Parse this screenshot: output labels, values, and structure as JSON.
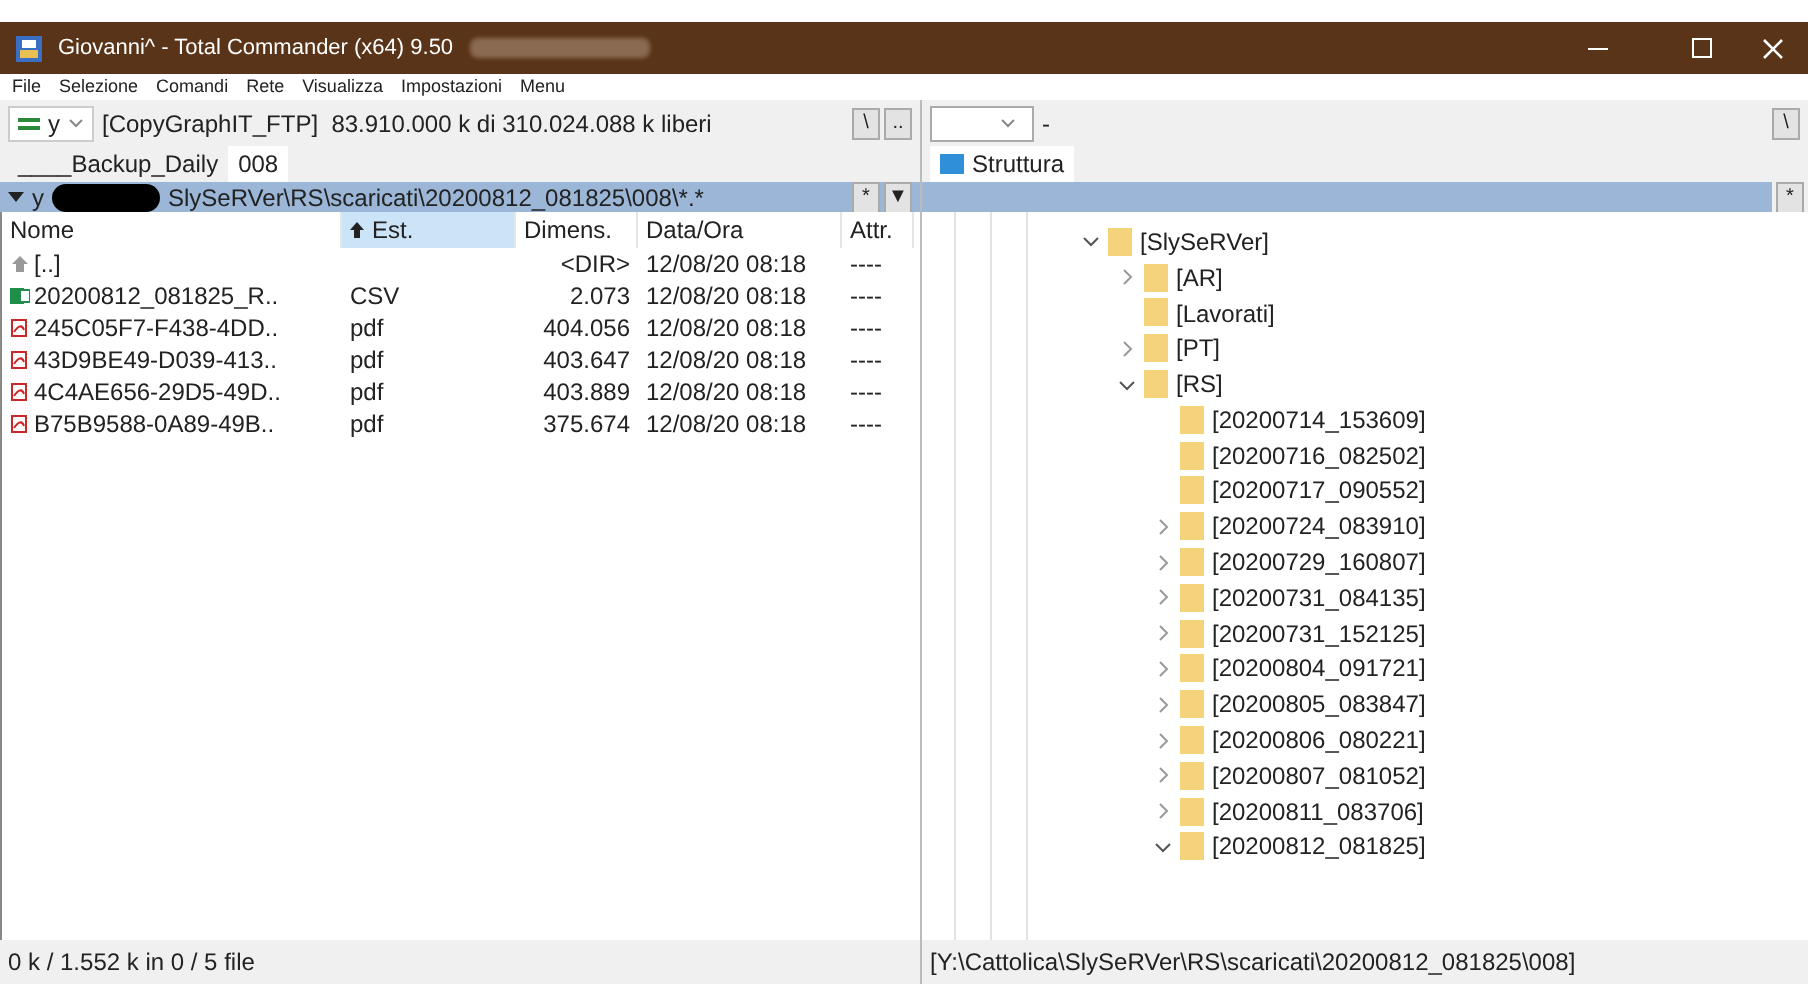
{
  "window": {
    "title": "Giovanni^ - Total Commander (x64) 9.50"
  },
  "menu": [
    "File",
    "Selezione",
    "Comandi",
    "Rete",
    "Visualizza",
    "Impostazioni",
    "Menu"
  ],
  "left": {
    "drive": "y",
    "drive_info": "[CopyGraphIT_FTP]  83.910.000 k di 310.024.088 k liberi",
    "buttons": [
      "\\",
      ".."
    ],
    "tabs": [
      {
        "label": "____Backup_Daily",
        "selected": false
      },
      {
        "label": "008",
        "selected": true
      }
    ],
    "path_prefix": "y",
    "path": "SlySeRVer\\RS\\scaricati\\20200812_081825\\008\\*.*",
    "path_buttons": [
      "*",
      "▼"
    ],
    "columns": [
      {
        "label": "Nome",
        "sorted": false
      },
      {
        "label": "Est.",
        "sorted": true
      },
      {
        "label": "Dimens.",
        "sorted": false
      },
      {
        "label": "Data/Ora",
        "sorted": false
      },
      {
        "label": "Attr.",
        "sorted": false
      }
    ],
    "rows": [
      {
        "kind": "up",
        "name": "[..]",
        "ext": "",
        "size": "<DIR>",
        "date": "12/08/20 08:18",
        "attr": "----"
      },
      {
        "kind": "csv",
        "name": "20200812_081825_R..",
        "ext": "CSV",
        "size": "2.073",
        "date": "12/08/20 08:18",
        "attr": "----"
      },
      {
        "kind": "pdf",
        "name": "245C05F7-F438-4DD..",
        "ext": "pdf",
        "size": "404.056",
        "date": "12/08/20 08:18",
        "attr": "----"
      },
      {
        "kind": "pdf",
        "name": "43D9BE49-D039-413..",
        "ext": "pdf",
        "size": "403.647",
        "date": "12/08/20 08:18",
        "attr": "----"
      },
      {
        "kind": "pdf",
        "name": "4C4AE656-29D5-49D..",
        "ext": "pdf",
        "size": "403.889",
        "date": "12/08/20 08:18",
        "attr": "----"
      },
      {
        "kind": "pdf",
        "name": "B75B9588-0A89-49B..",
        "ext": "pdf",
        "size": "375.674",
        "date": "12/08/20 08:18",
        "attr": "----"
      }
    ],
    "status": "0 k / 1.552 k in 0 / 5 file"
  },
  "right": {
    "drive_info": "-",
    "buttons": [
      "\\"
    ],
    "tabs": [
      {
        "label": "Struttura",
        "selected": true
      }
    ],
    "path_buttons": [
      "*"
    ],
    "tree": [
      {
        "label": "[SlySeRVer]",
        "expanded": true,
        "children": [
          {
            "label": "[AR]",
            "expanded": false
          },
          {
            "label": "[Lavorati]"
          },
          {
            "label": "[PT]",
            "expanded": false
          },
          {
            "label": "[RS]",
            "expanded": true,
            "children": [
              {
                "label": "[20200714_153609]"
              },
              {
                "label": "[20200716_082502]"
              },
              {
                "label": "[20200717_090552]"
              },
              {
                "label": "[20200724_083910]",
                "expanded": false
              },
              {
                "label": "[20200729_160807]",
                "expanded": false
              },
              {
                "label": "[20200731_084135]",
                "expanded": false
              },
              {
                "label": "[20200731_152125]",
                "expanded": false
              },
              {
                "label": "[20200804_091721]",
                "expanded": false
              },
              {
                "label": "[20200805_083847]",
                "expanded": false
              },
              {
                "label": "[20200806_080221]",
                "expanded": false
              },
              {
                "label": "[20200807_081052]",
                "expanded": false
              },
              {
                "label": "[20200811_083706]",
                "expanded": false
              },
              {
                "label": "[20200812_081825]",
                "expanded": true
              }
            ]
          }
        ]
      }
    ],
    "status": "[Y:\\Cattolica\\SlySeRVer\\RS\\scaricati\\20200812_081825\\008]"
  }
}
